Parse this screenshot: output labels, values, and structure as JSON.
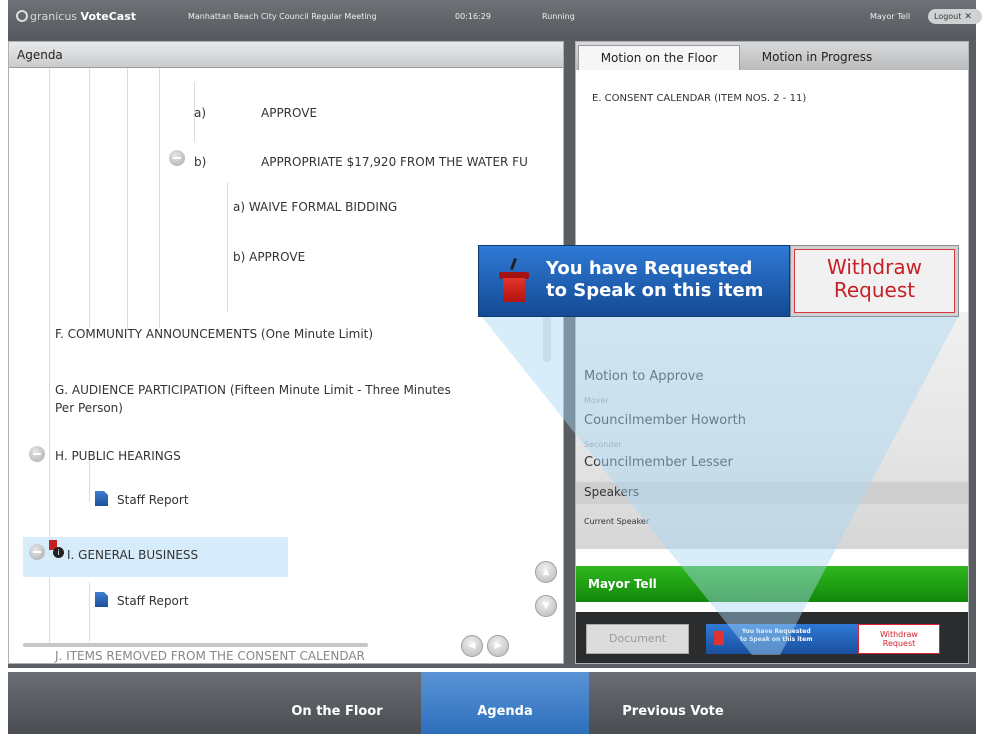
{
  "topbar": {
    "brand_prefix": "granicus",
    "brand_name": "VoteCast",
    "meeting": "Manhattan Beach City Council Regular Meeting",
    "clock": "00:16:29",
    "status": "Running",
    "user": "Mayor Tell",
    "logout_label": "Logout",
    "logout_icon": "close-icon"
  },
  "agenda": {
    "title": "Agenda",
    "items": {
      "a_approve_letter": "a)",
      "a_approve_text": "APPROVE",
      "b_appropriate_letter": "b)",
      "b_appropriate_text": "APPROPRIATE $17,920 FROM THE WATER FU",
      "waive_bidding": "a) WAIVE FORMAL BIDDING",
      "b_approve": "b) APPROVE",
      "f_announcements": "F. COMMUNITY ANNOUNCEMENTS (One Minute Limit)",
      "g_audience_line1": "G. AUDIENCE PARTICIPATION (Fifteen Minute Limit - Three Minutes",
      "g_audience_line2": "Per Person)",
      "h_hearings": "H. PUBLIC HEARINGS",
      "h_staff_report": "Staff Report",
      "i_general_business": "I. GENERAL BUSINESS",
      "i_staff_report": "Staff Report",
      "j_items_removed": "J. ITEMS REMOVED FROM THE CONSENT CALENDAR"
    }
  },
  "right_panel": {
    "tabs": [
      "Motion on the Floor",
      "Motion in Progress"
    ],
    "motion_item": "E. CONSENT CALENDAR (ITEM NOS. 2 - 11)",
    "motion_label": "Motion to Approve",
    "mover_caption": "Mover",
    "mover": "Councilmember Howorth",
    "seconder_caption": "Seconder",
    "seconder": "Councilmember Lesser",
    "speakers_label": "Speakers",
    "current_speaker_label": "Current Speaker",
    "speaker_name": "Mayor Tell",
    "document_button": "Document",
    "mini_request_line1": "You have Requested",
    "mini_request_line2": "to Speak on this item",
    "mini_withdraw_line1": "Withdraw",
    "mini_withdraw_line2": "Request"
  },
  "banner": {
    "request_line1": "You have Requested",
    "request_line2": "to Speak on this item",
    "withdraw_line1": "Withdraw",
    "withdraw_line2": "Request"
  },
  "nav": {
    "items": [
      "On the Floor",
      "Agenda",
      "Previous Vote"
    ],
    "active": "Agenda"
  },
  "colors": {
    "accent_blue": "#2d6fbc",
    "speaker_green": "#1ea514",
    "withdraw_red": "#c81f27",
    "selection": "#d6ecfb"
  }
}
